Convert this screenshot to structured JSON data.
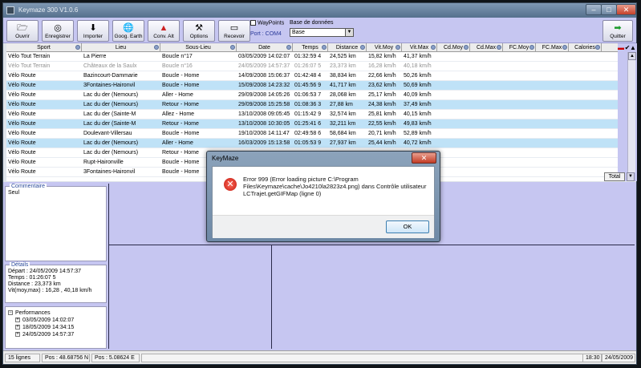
{
  "window": {
    "title": "Keymaze 300 V1.0.6"
  },
  "toolbar": {
    "buttons": [
      {
        "label": "Ouvrir",
        "icon": "folder-icon"
      },
      {
        "label": "Enregistrer",
        "icon": "disc-icon"
      },
      {
        "label": "Importer",
        "icon": "download-icon"
      },
      {
        "label": "Goog. Earth",
        "icon": "globe-icon"
      },
      {
        "label": "Conv. Alt",
        "icon": "chart-icon"
      },
      {
        "label": "Options",
        "icon": "tools-icon"
      },
      {
        "label": "Recevoir",
        "icon": "device-icon"
      }
    ],
    "waypoints_label": "WayPoints",
    "port_label": "Port : COM4",
    "base_label": "Base de données",
    "base_value": "Base",
    "quit_label": "Quitter"
  },
  "table": {
    "columns": [
      "Sport",
      "Lieu",
      "Sous-Lieu",
      "Date",
      "Temps",
      "Distance",
      "Vit.Moy",
      "Vit.Max",
      "Cd.Moy",
      "Cd.Max",
      "FC.Moy",
      "FC.Max",
      "Calories"
    ],
    "rows": [
      [
        "Vélo Tout Terrain",
        "La Pierre",
        "Boucle n°17",
        "03/05/2009 14:02:07",
        "01:32:59 4",
        "24,525 km",
        "15,82 km/h",
        "41,37 km/h"
      ],
      [
        "Vélo Tout Terrain",
        "Châteaux de la Saulx",
        "Boucle n°16",
        "24/05/2009 14:57:37",
        "01:26:07 5",
        "23,373 km",
        "16,28 km/h",
        "40,18 km/h"
      ],
      [
        "Vélo Route",
        "Bazincourt-Dammarie",
        "Boucle - Home",
        "14/09/2008 15:06:37",
        "01:42:48 4",
        "38,834 km",
        "22,66 km/h",
        "50,26 km/h"
      ],
      [
        "Vélo Route",
        "3Fontaines-Haironvil",
        "Boucle - Home",
        "15/09/2008 14:23:32",
        "01:45:56 9",
        "41,717 km",
        "23,62 km/h",
        "50,69 km/h"
      ],
      [
        "Vélo Route",
        "Lac du der (Nemours)",
        "Aller - Home",
        "29/09/2008 14:05:26",
        "01:06:53 7",
        "28,068 km",
        "25,17 km/h",
        "40,09 km/h"
      ],
      [
        "Vélo Route",
        "Lac du der (Nemours)",
        "Retour - Home",
        "29/09/2008 15:25:58",
        "01:08:36 3",
        "27,88 km",
        "24,38 km/h",
        "37,49 km/h"
      ],
      [
        "Vélo Route",
        "Lac du der (Sainte-M",
        "Allez - Home",
        "13/10/2008 09:05:45",
        "01:15:42 9",
        "32,574 km",
        "25,81 km/h",
        "40,15 km/h"
      ],
      [
        "Vélo Route",
        "Lac du der (Sainte-M",
        "Retour - Home",
        "13/10/2008 10:30:05",
        "01:25:41 6",
        "32,211 km",
        "22,55 km/h",
        "49,83 km/h"
      ],
      [
        "Vélo Route",
        "Doulevant-Villersau",
        "Boucle - Home",
        "19/10/2008 14:11:47",
        "02:49:58 6",
        "58,684 km",
        "20,71 km/h",
        "52,89 km/h"
      ],
      [
        "Vélo Route",
        "Lac du der (Nemours)",
        "Aller - Home",
        "16/03/2009 15:13:58",
        "01:05:53 9",
        "27,937 km",
        "25,44 km/h",
        "40,72 km/h"
      ],
      [
        "Vélo Route",
        "Lac du der (Nemours)",
        "Retour - Home",
        "",
        "",
        "",
        "",
        ""
      ],
      [
        "Vélo Route",
        "Rupt-Haironville",
        "Boucle - Home",
        "",
        "",
        "",
        "",
        ""
      ],
      [
        "Vélo Route",
        "3Fontaines-Haironvil",
        "Boucle - Home",
        "",
        "",
        "",
        "",
        ""
      ]
    ],
    "total_label": "Total"
  },
  "panels": {
    "comment_title": "Commentaire",
    "comment_text": "Seul",
    "details_title": "Détails",
    "details_lines": [
      "Départ : 24/05/2009 14:57:37",
      "Temps : 01:26:07 5",
      "Distance : 23,373 km",
      "Vit(moy,max) : 16,28 , 40,18 km/h"
    ],
    "perf_title": "Performances",
    "perf_items": [
      "03/05/2009 14:02:07",
      "18/05/2009 14:34:15",
      "24/05/2009 14:57:37"
    ]
  },
  "status": {
    "rows": "15 lignes",
    "pos_n": "Pos : 48.68756 N",
    "pos_e": "Pos : 5.08624 E",
    "time": "18:30",
    "date": "24/05/2009"
  },
  "dialog": {
    "title": "KeyMaze",
    "message": "Error 999 (Error loading picture C:\\Program Files\\Keymaze\\cache\\Jo4210la2823z4.png) dans Contrôle utilisateur LCTrajet.getGIFMap (ligne 0)",
    "ok_label": "OK"
  }
}
